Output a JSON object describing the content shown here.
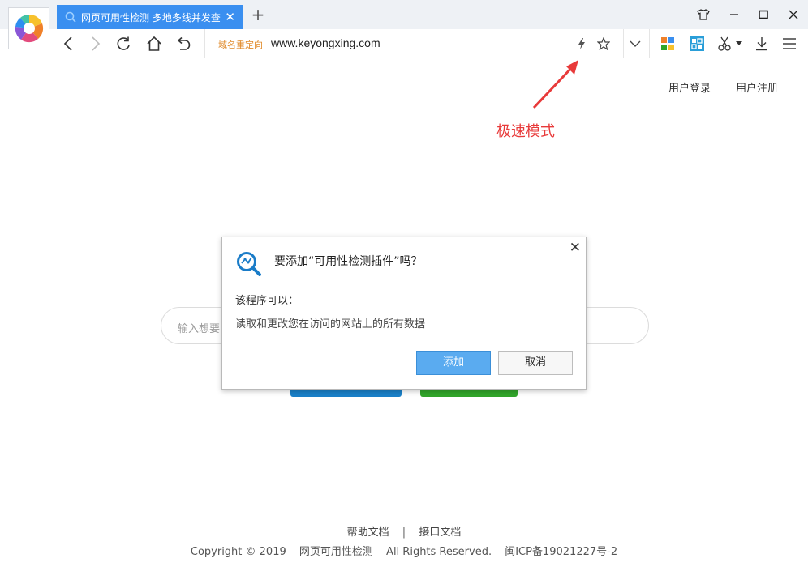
{
  "tab": {
    "title": "网页可用性检测 多地多线并发查",
    "close": "✕"
  },
  "newtab": "+",
  "window_controls": {
    "shirt": "shirt-icon",
    "minimize": "minimize-icon",
    "maximize": "maximize-icon",
    "close": "close-icon"
  },
  "address": {
    "redirect_label": "域名重定向",
    "url": "www.keyongxing.com"
  },
  "header": {
    "login": "用户登录",
    "register": "用户注册"
  },
  "annotation": "极速模式",
  "search": {
    "placeholder": "输入想要"
  },
  "dialog": {
    "title": "要添加“可用性检测插件”吗？",
    "label": "该程序可以：",
    "permission": "读取和更改您在访问的网站上的所有数据",
    "add": "添加",
    "cancel": "取消",
    "close": "✕"
  },
  "footer": {
    "help": "帮助文档",
    "separator": "|",
    "api": "接口文档",
    "copyright": "Copyright © 2019",
    "site_name": "网页可用性检测",
    "rights": "All Rights Reserved.",
    "icp": "闽ICP备19021227号-2"
  },
  "colors": {
    "accent": "#3a8ff0",
    "annotation": "#e83a3a",
    "add_button": "#5aabf0",
    "green_button": "#31a52a",
    "blue_button": "#1a80c8"
  }
}
